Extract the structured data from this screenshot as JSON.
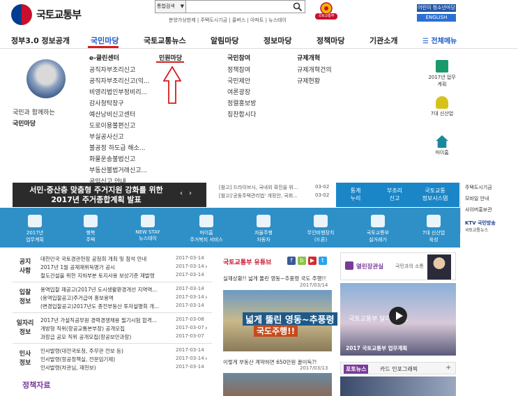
{
  "header": {
    "logo_text": "국토교통부",
    "search_select": "통합검색",
    "quick_links": "분양가상한제 | 주택도시기금 | 콜버스 | 아파트 | 뉴스테이",
    "emblem_label": "국토교통부",
    "btn_young": "어린이 청소년마당",
    "btn_english": "ENGLISH"
  },
  "nav": {
    "items": [
      "정부3.0 정보공개",
      "국민마당",
      "국토교통뉴스",
      "알림마당",
      "정보마당",
      "정책마당",
      "기관소개"
    ],
    "all_menu": "☰ 전체메뉴"
  },
  "dropdown": {
    "side_text1": "국민과 함께하는",
    "side_text2": "국민마당",
    "col1_head": "e-클린센터",
    "col1_items": [
      "공직자부조리신고",
      "공직자부조리신고(익...",
      "비영리법인부정비리...",
      "감사청탁창구",
      "예산낭비신고센터",
      "도로이용불편신고",
      "부실공사신고",
      "불공정 하도급 해소...",
      "화물운송불법신고",
      "부동산불법거래신고...",
      "공익신고 안내"
    ],
    "col2_head": "민원마당",
    "col3_head": "국민참여",
    "col3_items": [
      "정책참여",
      "국민제안",
      "여론광장",
      "정렬홍보방",
      "칭찬합시다"
    ],
    "col4_head": "규제개혁",
    "col4_items": [
      "규제개혁건의",
      "규제현황"
    ],
    "quick": [
      {
        "label": "2017년 업무계획",
        "icon": "document-icon"
      },
      {
        "label": "7대 신산업",
        "icon": "person-icon"
      },
      {
        "label": "마이홈",
        "icon": "home-icon"
      }
    ]
  },
  "banner": {
    "line1": "서민·중산층 맞춤형 주거지원 강화를 위한",
    "line2": "2017년 주거종합계획 발표",
    "prev": "‹",
    "next": "›",
    "news": [
      {
        "title": "[참고]'공동주택관리법' 개정안, 국회...",
        "date": "03-02"
      }
    ],
    "news_top": {
      "title": "[참고] 드라이브시, 국내외 확진을 위...",
      "date": "03-02"
    },
    "blue_cells": [
      {
        "l1": "통계",
        "l2": "누리"
      },
      {
        "l1": "부조리",
        "l2": "신고"
      },
      {
        "l1": "국토교통",
        "l2": "정보시스템"
      }
    ],
    "right_items": [
      "주택도시기금",
      "모바일 안내",
      "사이버홍보관"
    ],
    "ktv_label": "KTV 국민방송",
    "ktv_sub": "국토교통뉴스"
  },
  "band": [
    {
      "l1": "2017년",
      "l2": "업무계획"
    },
    {
      "l1": "행복",
      "l2": "주택"
    },
    {
      "l1": "NEW STAY",
      "l2": "뉴스테이"
    },
    {
      "l1": "마이홈",
      "l2": "주거복지 서비스"
    },
    {
      "l1": "자율주행",
      "l2": "자동차"
    },
    {
      "l1": "무인비행장치",
      "l2": "(드론)"
    },
    {
      "l1": "국토교통부",
      "l2": "실거래가"
    },
    {
      "l1": "7대 신산업",
      "l2": "육성"
    }
  ],
  "news": [
    {
      "cat": "공지\n사항",
      "lines": [
        {
          "t": "대한민국 국토경관헌장 공청회 개최 및 참석 안내",
          "d": "2017-03-14"
        },
        {
          "t": "2017년 1월 공재재위득명가 공시",
          "d": "2017-03-14"
        },
        {
          "t": "철도건설을 위한 지하부분 토지사용 보상기준 재발령",
          "d": "2017-03-14"
        }
      ]
    },
    {
      "cat": "입찰\n정보",
      "lines": [
        {
          "t": "용역입찰 재공고(2017년 도시생활환경개선 지역역...",
          "d": "2017-03-14"
        },
        {
          "t": "(용역입찰공고)주거급여 홍보용역",
          "d": "2017-03-14"
        },
        {
          "t": "(변경입찰공고)2017년도 종전부동산 투자설명회 개...",
          "d": "2017-03-14"
        }
      ]
    },
    {
      "cat": "일자리\n정보",
      "lines": [
        {
          "t": "2017년 가설직공무원 경력경쟁채용 필기시험 합격...",
          "d": "2017-03-08"
        },
        {
          "t": "개방형 직위(항공교통본부장) 공개모집",
          "d": "2017-03-07"
        },
        {
          "t": "과장급 공모 직위 공개모집(항공보안과장)",
          "d": "2017-03-07"
        }
      ]
    },
    {
      "cat": "인사\n정보",
      "lines": [
        {
          "t": "인사발령(대전국토청, 주무관 전보 등)",
          "d": "2017-03-14"
        },
        {
          "t": "인사발령(항공정책실, 전문임기제)",
          "d": "2017-03-14"
        },
        {
          "t": "인사발령(차관님, 재천보)",
          "d": "2017-03-14"
        }
      ]
    }
  ],
  "policy_title": "정책자료",
  "youtube": {
    "title": "국토교통부 유튜브",
    "caption1": "실제상황!! 넓게 뚫린 영동~추풍령 국도 주행!!",
    "date1": "2017/03/14",
    "thumb_t1": "넓게 뚫린 영동~추풍령",
    "thumb_t2": "국도주행!!",
    "caption2": "이렇게 부동산 계약하면 650만원 꿀이득?!",
    "date2": "2017/03/13"
  },
  "minister": {
    "title": "열린장관실",
    "sub": "국민과의 소통",
    "video_title": "국토교통부 달라졌어요",
    "video_caption": "2017 국토교통부 업무계획"
  },
  "photo_tabs": {
    "tab1": "포토뉴스",
    "tab2": "카드 인포그래픽",
    "plus": "+"
  }
}
